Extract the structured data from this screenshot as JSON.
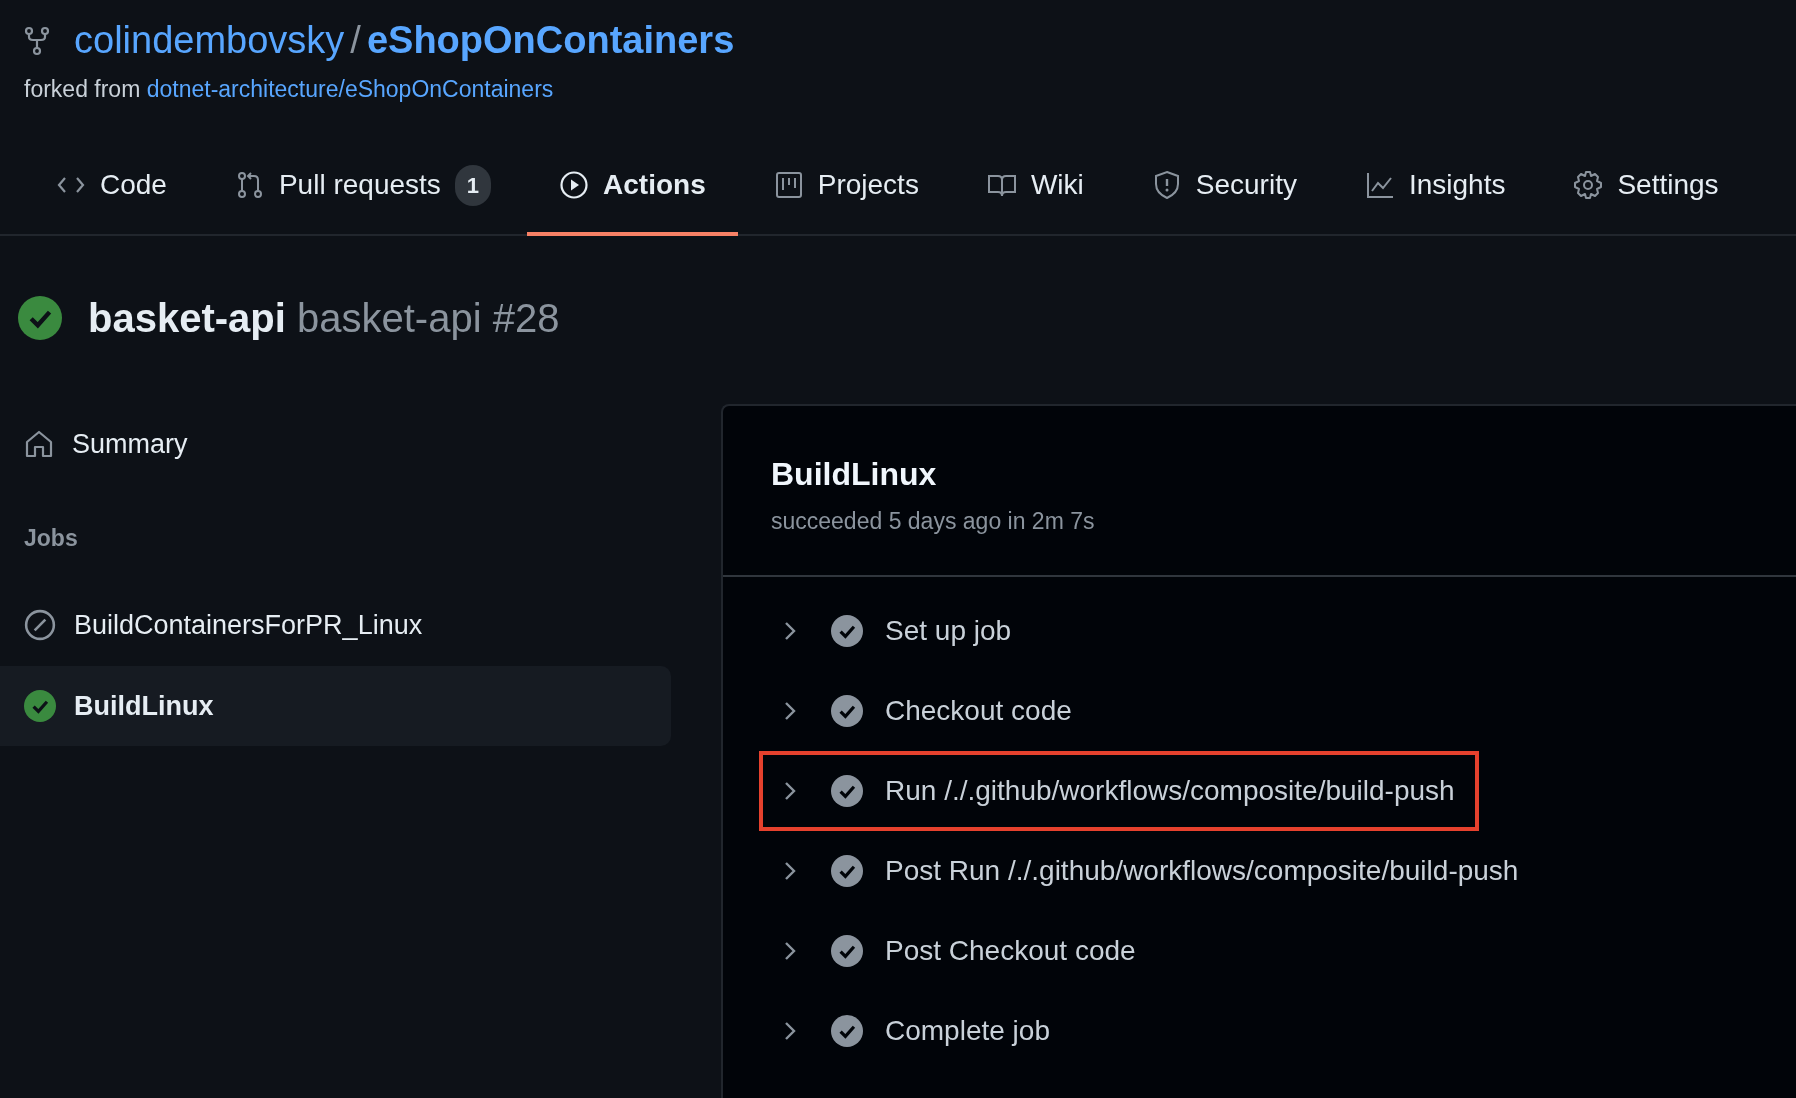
{
  "repo": {
    "owner": "colindembovsky",
    "separator": "/",
    "name": "eShopOnContainers",
    "forked_label": "forked from",
    "forked_from": "dotnet-architecture/eShopOnContainers"
  },
  "tabs": [
    {
      "label": "Code",
      "kind": "code",
      "selected": false
    },
    {
      "label": "Pull requests",
      "kind": "pr",
      "count": "1",
      "selected": false
    },
    {
      "label": "Actions",
      "kind": "play",
      "selected": true
    },
    {
      "label": "Projects",
      "kind": "project",
      "selected": false
    },
    {
      "label": "Wiki",
      "kind": "book",
      "selected": false
    },
    {
      "label": "Security",
      "kind": "shield",
      "selected": false
    },
    {
      "label": "Insights",
      "kind": "graph",
      "selected": false
    },
    {
      "label": "Settings",
      "kind": "gear",
      "selected": false
    }
  ],
  "run": {
    "kind": "success",
    "workflow": "basket-api",
    "title": "basket-api #28"
  },
  "sidebar": {
    "summary": "Summary",
    "jobs_heading": "Jobs",
    "jobs": [
      {
        "name": "BuildContainersForPR_Linux",
        "kind": "skipped",
        "selected": false
      },
      {
        "name": "BuildLinux",
        "kind": "success",
        "selected": true
      }
    ]
  },
  "job": {
    "name": "BuildLinux",
    "subtitle": "succeeded 5 days ago in 2m 7s",
    "steps": [
      {
        "name": "Set up job",
        "highlighted": false
      },
      {
        "name": "Checkout code",
        "highlighted": false
      },
      {
        "name": "Run /./.github/workflows/composite/build-push",
        "highlighted": true
      },
      {
        "name": "Post Run /./.github/workflows/composite/build-push",
        "highlighted": false
      },
      {
        "name": "Post Checkout code",
        "highlighted": false
      },
      {
        "name": "Complete job",
        "highlighted": false
      }
    ]
  }
}
